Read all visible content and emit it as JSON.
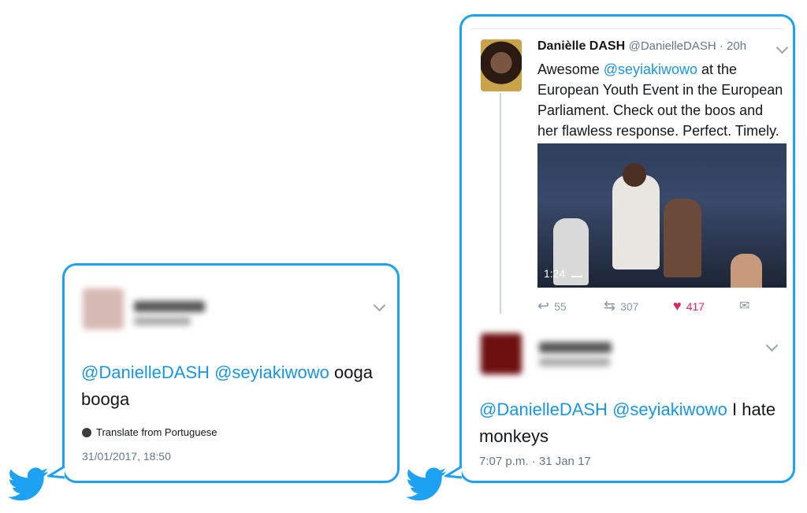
{
  "left_tweet": {
    "reply_mentions": [
      "@DanielleDASH",
      "@seyiakiwowo"
    ],
    "text_line1_rest": " ooga",
    "text_line2": "booga",
    "translate_label": "Translate from Portuguese",
    "timestamp": "31/01/2017, 18:50"
  },
  "right_quoted_tweet": {
    "display_name": "Danièlle DASH",
    "handle_time": "@DanielleDASH · 20h",
    "lines": [
      {
        "pre": "Awesome ",
        "mention": "@seyiakiwowo",
        "post": " at the"
      },
      {
        "pre": "European Youth Event in the European",
        "mention": "",
        "post": ""
      },
      {
        "pre": "Parliament. Check out the boos and",
        "mention": "",
        "post": ""
      },
      {
        "pre": "her flawless response. Perfect. Timely.",
        "mention": "",
        "post": ""
      }
    ],
    "video_duration": "1:24",
    "actions": {
      "replies": "55",
      "retweets": "307",
      "likes": "417"
    }
  },
  "right_reply_tweet": {
    "reply_mentions": [
      "@DanielleDASH",
      "@seyiakiwowo"
    ],
    "text_line1_rest": " I hate",
    "text_line2": "monkeys",
    "timestamp": "7:07 p.m. · 31 Jan 17"
  },
  "colors": {
    "twitter_blue": "#1da1f2",
    "mention_blue": "#1b95e0",
    "like_red": "#e0245e",
    "muted": "#657786"
  },
  "icons": [
    "twitter-bird-icon",
    "chevron-down-icon",
    "globe-icon",
    "reply-icon",
    "retweet-icon",
    "heart-icon",
    "dm-icon",
    "signal-icon"
  ]
}
